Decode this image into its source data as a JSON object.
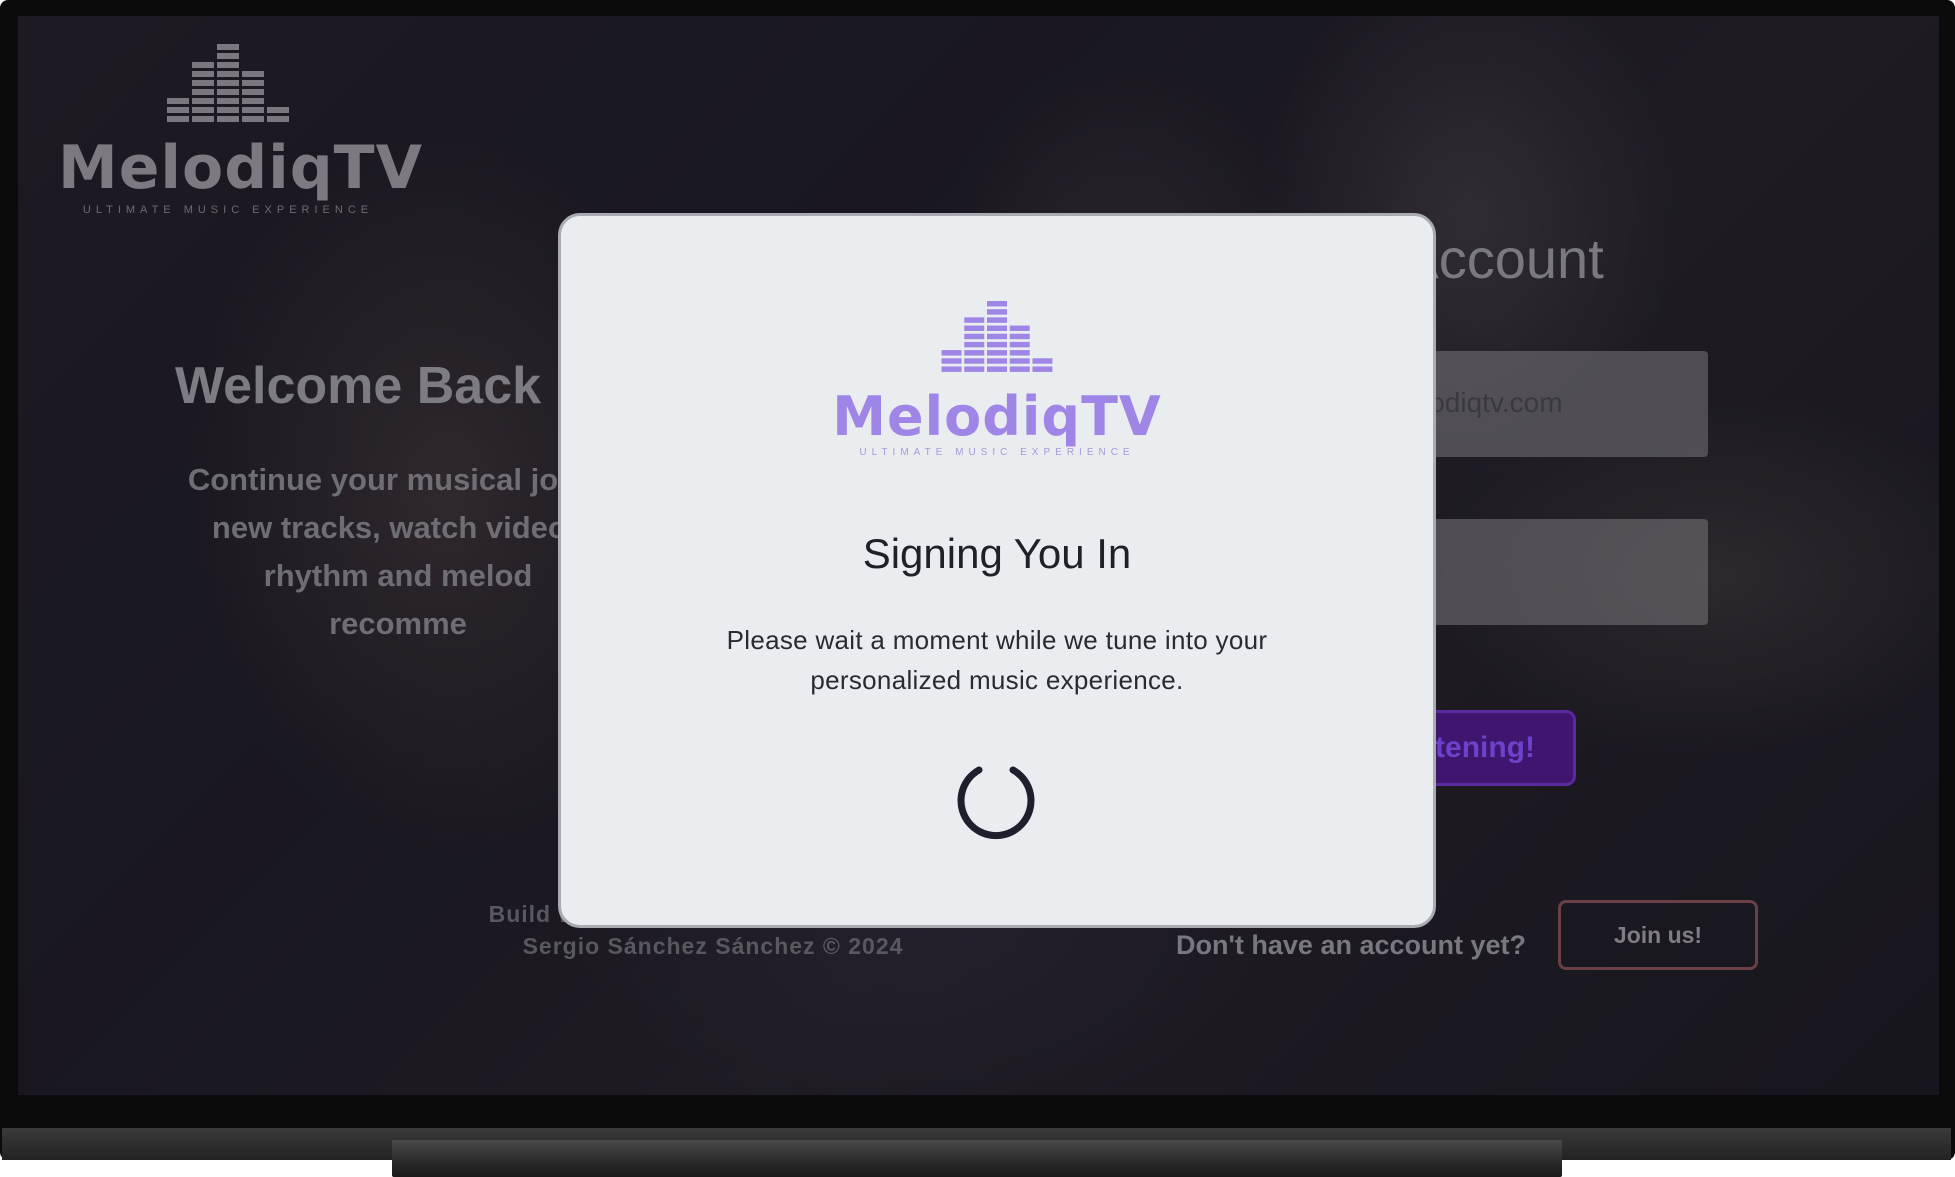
{
  "brand": {
    "name": "MelodiqTV",
    "tagline": "ULTIMATE MUSIC EXPERIENCE"
  },
  "welcome": {
    "title": "Welcome Back",
    "line1": "Continue your musical journ",
    "line2": "new tracks, watch videos",
    "line3": "rhythm and melod",
    "line4": "recomme"
  },
  "footer": {
    "line1": "Build with passion by dreamsoftware.",
    "line2": "Sergio Sánchez Sánchez © 2024"
  },
  "login": {
    "title": "our Account",
    "email_value": "lodiqtv.com",
    "submit_label": "tening!",
    "no_account": "Don't have an account yet?",
    "join_label": "Join us!"
  },
  "modal": {
    "title": "Signing You In",
    "message_line1": "Please wait a moment while we tune into your",
    "message_line2": "personalized music experience."
  },
  "colors": {
    "brand_purple": "#9f85e6",
    "primary_button": "#3f1570"
  },
  "icons": {
    "logo": "equalizer-bars-icon",
    "loading": "spinner-icon"
  }
}
